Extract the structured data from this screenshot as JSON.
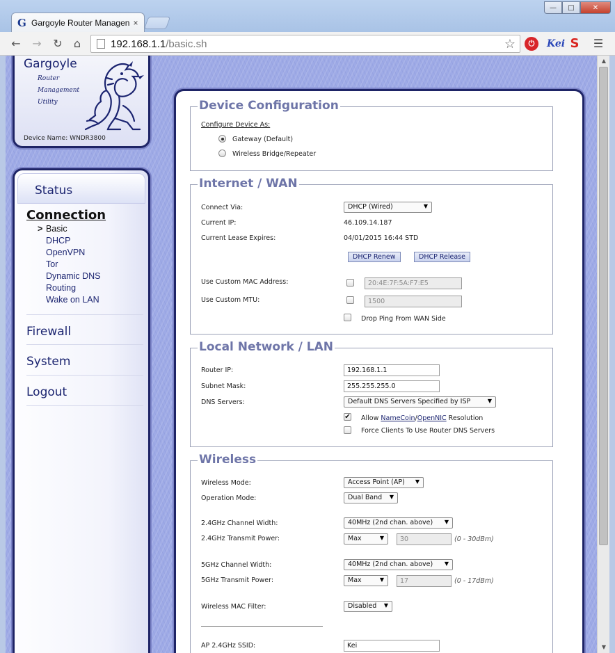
{
  "browser": {
    "tab_title": "Gargoyle Router Managen",
    "tab_close": "×",
    "tab_logo": "G",
    "url_host": "192.168.1.1",
    "url_path": "/basic.sh",
    "window_min": "—",
    "window_max": "□",
    "window_close": "✕",
    "ext_kei": "Kei",
    "ext_s": "S"
  },
  "logo": {
    "title": "Gargoyle",
    "sub": [
      "Router",
      "Management",
      "Utility"
    ],
    "device_name_label": "Device Name:",
    "device_name": "WNDR3800"
  },
  "nav": {
    "status": "Status",
    "connection": "Connection",
    "current_marker": ">",
    "sub_items": [
      "Basic",
      "DHCP",
      "OpenVPN",
      "Tor",
      "Dynamic DNS",
      "Routing",
      "Wake on LAN"
    ],
    "main_items": [
      "Firewall",
      "System",
      "Logout"
    ]
  },
  "device_config": {
    "title": "Device Configuration",
    "configure_label": "Configure Device As:",
    "options": [
      "Gateway (Default)",
      "Wireless Bridge/Repeater"
    ],
    "selected": 0
  },
  "wan": {
    "title": "Internet / WAN",
    "connect_via_label": "Connect Via:",
    "connect_via": "DHCP (Wired)",
    "current_ip_label": "Current IP:",
    "current_ip": "46.109.14.187",
    "lease_label": "Current Lease Expires:",
    "lease": "04/01/2015 16:44 STD",
    "renew_button": "DHCP Renew",
    "release_button": "DHCP Release",
    "custom_mac_label": "Use Custom MAC Address:",
    "custom_mac_value": "20:4E:7F:5A:F7:E5",
    "custom_mtu_label": "Use Custom MTU:",
    "custom_mtu_value": "1500",
    "drop_ping_label": "Drop Ping From WAN Side"
  },
  "lan": {
    "title": "Local Network / LAN",
    "router_ip_label": "Router IP:",
    "router_ip": "192.168.1.1",
    "subnet_label": "Subnet Mask:",
    "subnet": "255.255.255.0",
    "dns_label": "DNS Servers:",
    "dns_value": "Default DNS Servers Specified by ISP",
    "allow_prefix": "Allow ",
    "namecoin": "NameCoin",
    "slash": "/",
    "opennic": "OpenNIC",
    "allow_suffix": " Resolution",
    "force_clients": "Force Clients To Use Router DNS Servers"
  },
  "wireless": {
    "title": "Wireless",
    "mode_label": "Wireless Mode:",
    "mode": "Access Point (AP)",
    "op_mode_label": "Operation Mode:",
    "op_mode": "Dual Band",
    "ch24_width_label": "2.4GHz Channel Width:",
    "ch24_width": "40MHz (2nd chan. above)",
    "tx24_label": "2.4GHz Transmit Power:",
    "tx24": "Max",
    "tx24_value": "30",
    "tx24_hint": "(0 - 30dBm)",
    "ch5_width_label": "5GHz Channel Width:",
    "ch5_width": "40MHz (2nd chan. above)",
    "tx5_label": "5GHz Transmit Power:",
    "tx5": "Max",
    "tx5_value": "17",
    "tx5_hint": "(0 - 17dBm)",
    "mac_filter_label": "Wireless MAC Filter:",
    "mac_filter": "Disabled",
    "ssid_label": "AP 2.4GHz SSID:",
    "ssid_value": "Kei"
  }
}
